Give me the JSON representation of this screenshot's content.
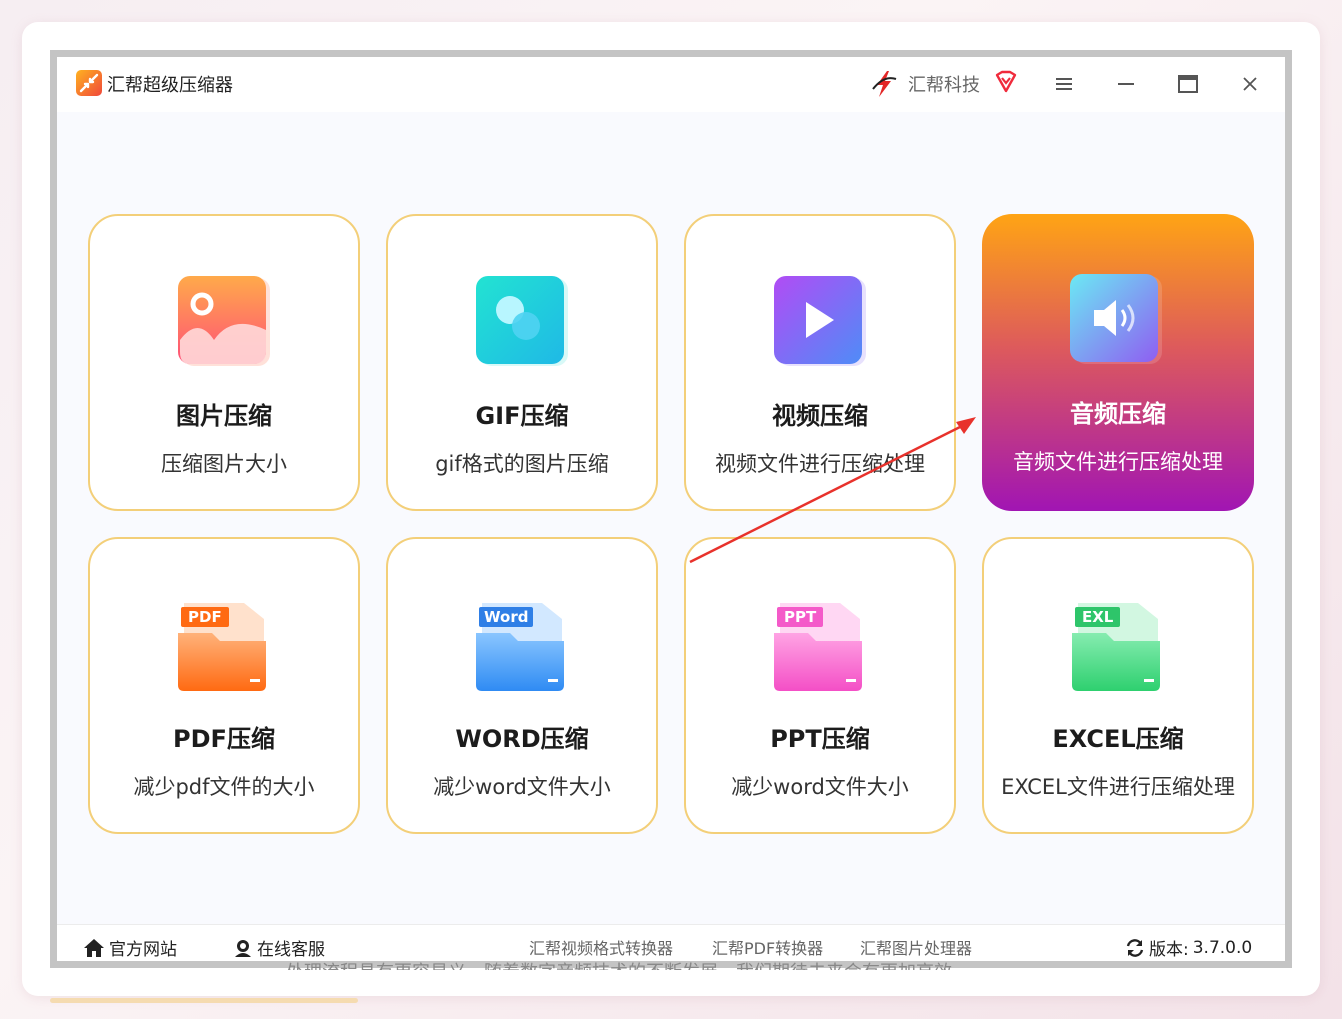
{
  "app": {
    "title": "汇帮超级压缩器",
    "brand": "汇帮科技"
  },
  "colors": {
    "tile_border": "#f3cf79",
    "active_top": "#ffa414",
    "active_bottom": "#a115b3",
    "arrow": "#e8322c"
  },
  "tiles": [
    {
      "title": "图片压缩",
      "desc": "压缩图片大小",
      "icon": "image-icon"
    },
    {
      "title": "GIF压缩",
      "desc": "gif格式的图片压缩",
      "icon": "gif-icon"
    },
    {
      "title": "视频压缩",
      "desc": "视频文件进行压缩处理",
      "icon": "video-play-icon"
    },
    {
      "title": "音频压缩",
      "desc": "音频文件进行压缩处理",
      "icon": "speaker-icon",
      "active": true
    },
    {
      "title": "PDF压缩",
      "desc": "减少pdf文件的大小",
      "icon": "pdf-folder-icon",
      "badge": "PDF"
    },
    {
      "title": "WORD压缩",
      "desc": "减少word文件大小",
      "icon": "word-folder-icon",
      "badge": "Word"
    },
    {
      "title": "PPT压缩",
      "desc": "减少word文件大小",
      "icon": "ppt-folder-icon",
      "badge": "PPT"
    },
    {
      "title": "EXCEL压缩",
      "desc": "EXCEL文件进行压缩处理",
      "icon": "excel-folder-icon",
      "badge": "EXL"
    }
  ],
  "footer": {
    "official_site": "官方网站",
    "online_service": "在线客服",
    "links": [
      "汇帮视频格式转换器",
      "汇帮PDF转换器",
      "汇帮图片处理器"
    ],
    "version_label": "版本:",
    "version": "3.7.0.0"
  },
  "background_text": "处理流程具有更容易义，随着数字音频技术的不断发展，我们期待未来会有更加高效"
}
